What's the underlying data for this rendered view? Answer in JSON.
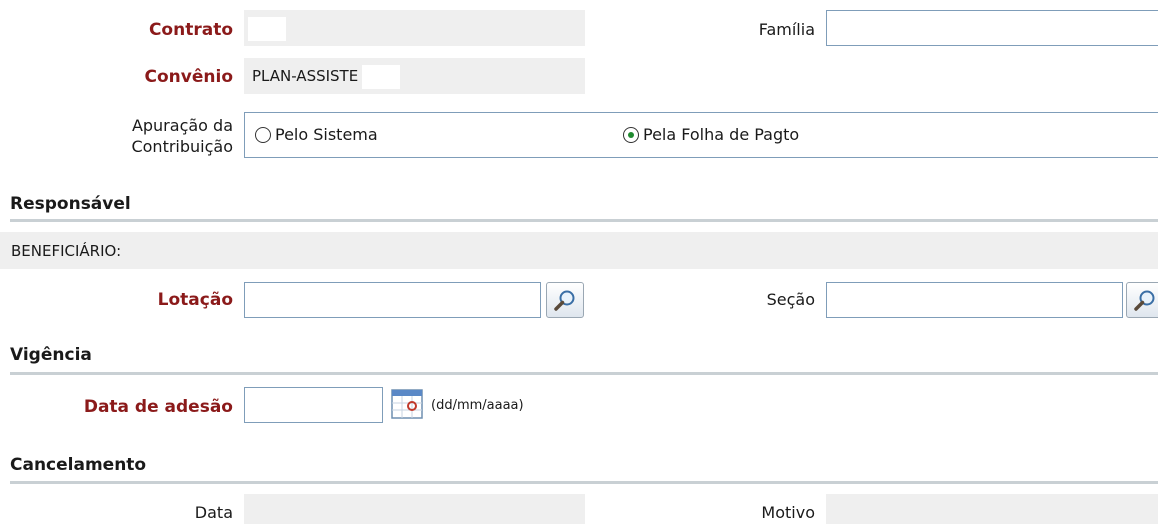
{
  "contract": {
    "label": "Contrato",
    "value": ""
  },
  "family": {
    "label": "Família",
    "value": ""
  },
  "agreement": {
    "label": "Convênio",
    "value": "PLAN-ASSISTE"
  },
  "contribution": {
    "label_line1": "Apuração da",
    "label_line2": "Contribuição",
    "options": [
      {
        "label": "Pelo Sistema",
        "selected": false
      },
      {
        "label": "Pela Folha de Pagto",
        "selected": true
      }
    ]
  },
  "responsible": {
    "heading": "Responsável",
    "beneficiary_label": "BENEFICIÁRIO:"
  },
  "allocation": {
    "label": "Lotação",
    "value": ""
  },
  "section_field": {
    "label": "Seção",
    "value": ""
  },
  "validity": {
    "heading": "Vigência",
    "date_label": "Data de adesão",
    "date_value": "",
    "date_hint": "(dd/mm/aaaa)"
  },
  "cancellation": {
    "heading": "Cancelamento",
    "date_label": "Data",
    "date_value": "",
    "reason_label": "Motivo",
    "reason_value": ""
  },
  "colors": {
    "required_label": "#8b1a1a",
    "readonly_bg": "#efefef",
    "divider": "#c9d0d4"
  },
  "icons": [
    "search-icon",
    "calendar-icon"
  ]
}
